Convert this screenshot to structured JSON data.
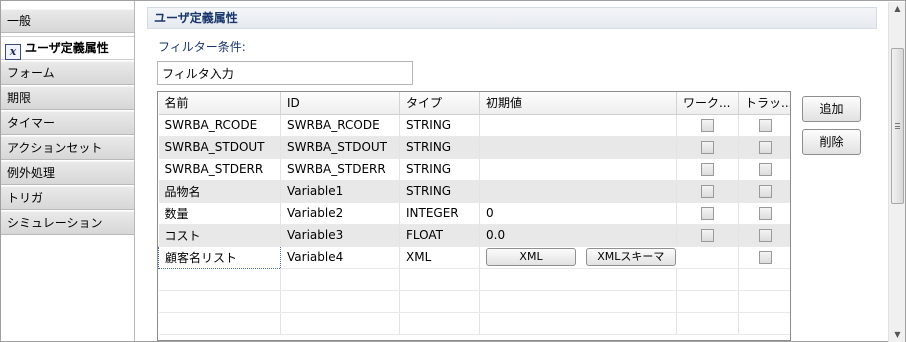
{
  "sidebar": {
    "items": [
      {
        "label": "一般"
      },
      {
        "label": "ユーザ定義属性",
        "icon": "x-variable-icon",
        "active": true
      },
      {
        "label": "フォーム"
      },
      {
        "label": "期限"
      },
      {
        "label": "タイマー"
      },
      {
        "label": "アクションセット"
      },
      {
        "label": "例外処理"
      },
      {
        "label": "トリガ"
      },
      {
        "label": "シミュレーション"
      }
    ]
  },
  "section": {
    "title": "ユーザ定義属性"
  },
  "filter": {
    "label": "フィルター条件:",
    "value": "フィルタ入力"
  },
  "table": {
    "columns": [
      "名前",
      "ID",
      "タイプ",
      "初期値",
      "ワーク...",
      "トラッ..."
    ],
    "rows": [
      {
        "name": "SWRBA_RCODE",
        "id": "SWRBA_RCODE",
        "type": "STRING",
        "initial": "",
        "work": false,
        "track": false
      },
      {
        "name": "SWRBA_STDOUT",
        "id": "SWRBA_STDOUT",
        "type": "STRING",
        "initial": "",
        "work": false,
        "track": false
      },
      {
        "name": "SWRBA_STDERR",
        "id": "SWRBA_STDERR",
        "type": "STRING",
        "initial": "",
        "work": false,
        "track": false
      },
      {
        "name": "品物名",
        "id": "Variable1",
        "type": "STRING",
        "initial": "",
        "work": false,
        "track": false
      },
      {
        "name": "数量",
        "id": "Variable2",
        "type": "INTEGER",
        "initial": "0",
        "work": false,
        "track": false
      },
      {
        "name": "コスト",
        "id": "Variable3",
        "type": "FLOAT",
        "initial": "0.0",
        "work": false,
        "track": false
      },
      {
        "name": "顧客名リスト",
        "id": "Variable4",
        "type": "XML",
        "initial": "",
        "work": null,
        "track": false,
        "buttons": {
          "xml": "XML",
          "schema": "XMLスキーマ"
        }
      }
    ]
  },
  "buttons": {
    "add": "追加",
    "delete": "削除"
  },
  "colors": {
    "header_text": "#19376d",
    "row_alt": "#e8e8e8"
  }
}
